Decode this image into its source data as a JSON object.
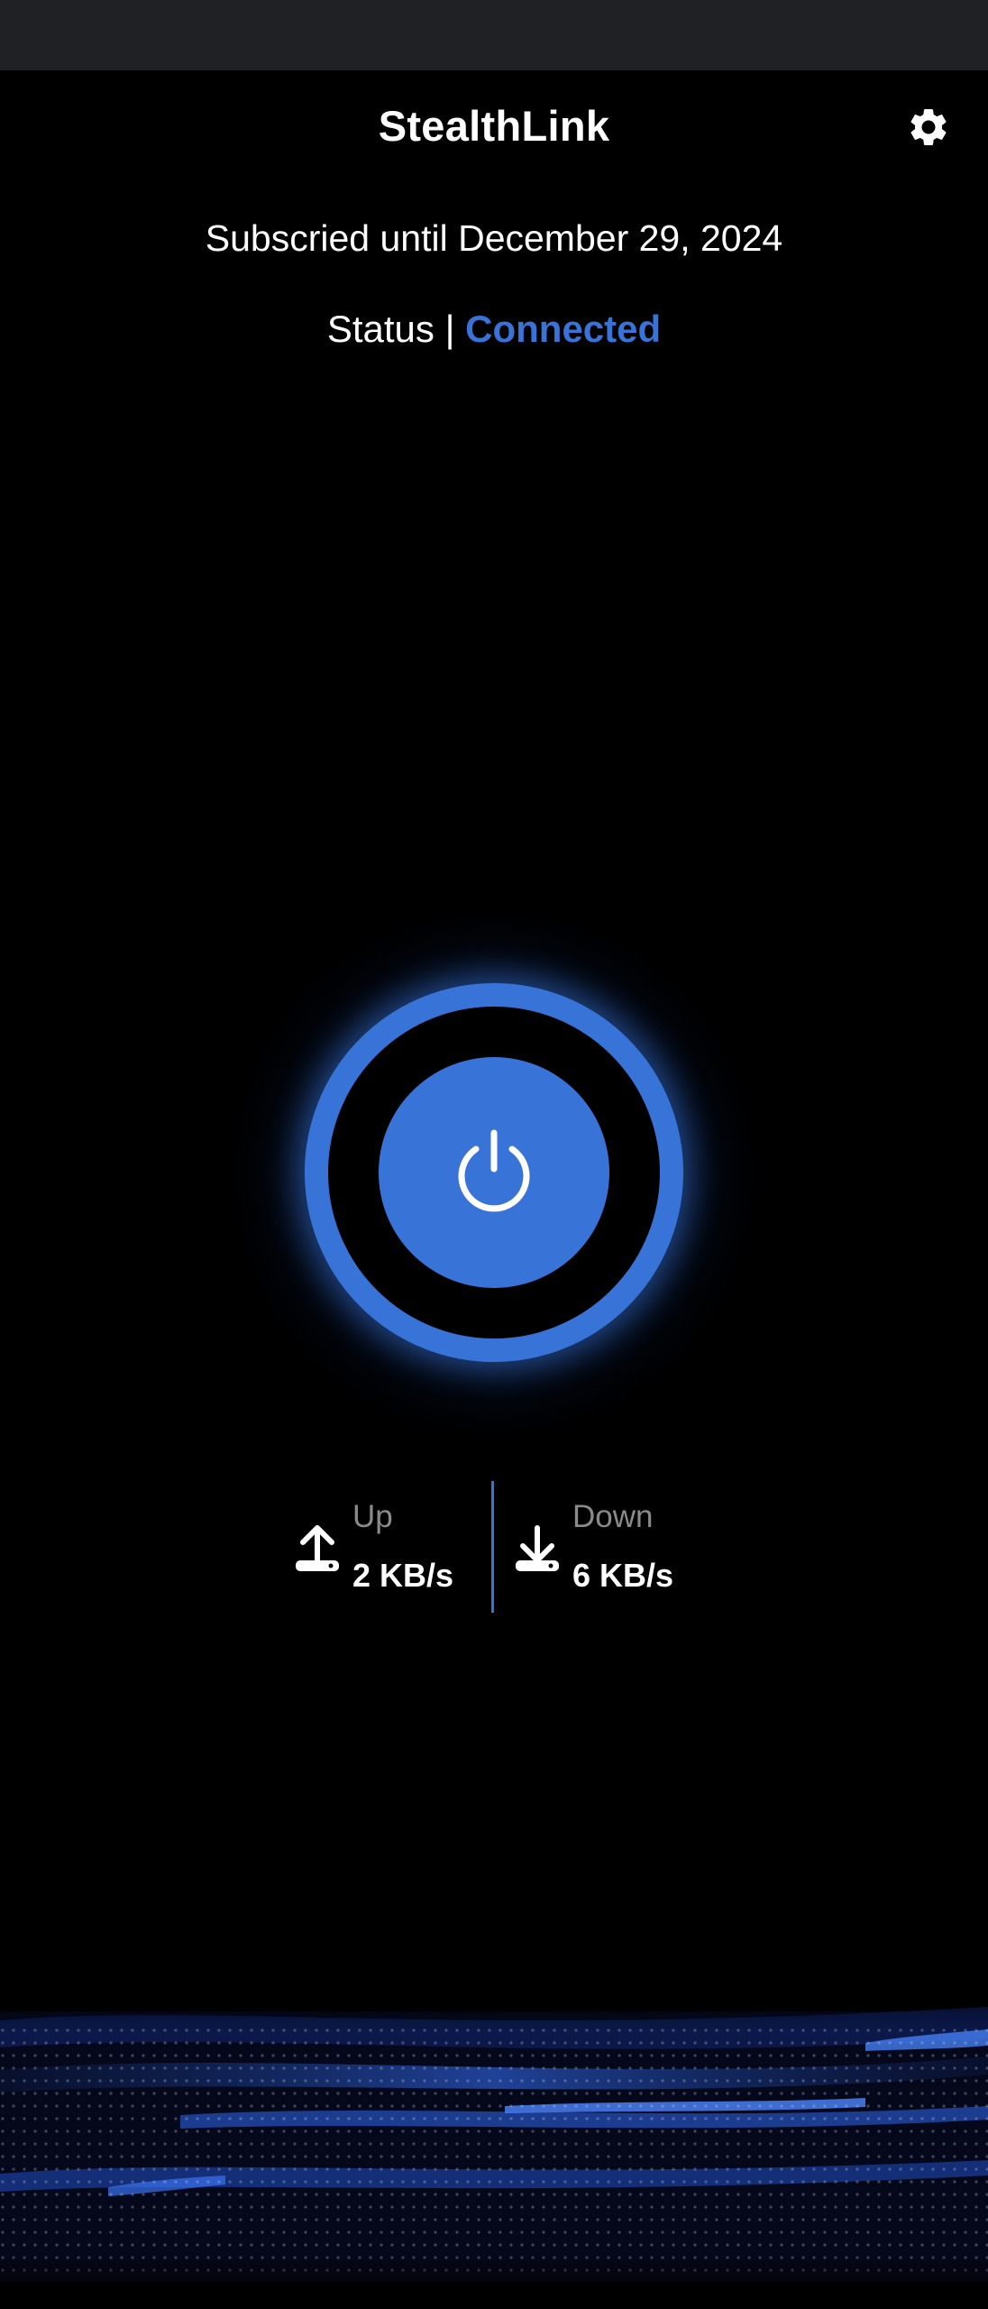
{
  "header": {
    "title": "StealthLink",
    "settings_icon": "gear-icon"
  },
  "subscription": {
    "text": "Subscried until December 29, 2024"
  },
  "status": {
    "label": "Status |",
    "value": "Connected"
  },
  "power": {
    "icon": "power-icon",
    "state": "on"
  },
  "stats": {
    "up": {
      "label": "Up",
      "value": "2 KB/s",
      "icon": "upload-icon"
    },
    "down": {
      "label": "Down",
      "value": "6 KB/s",
      "icon": "download-icon"
    }
  },
  "colors": {
    "accent": "#3874d8",
    "background": "#000000",
    "muted_text": "#8a8a8a",
    "status_bar": "#202124"
  }
}
